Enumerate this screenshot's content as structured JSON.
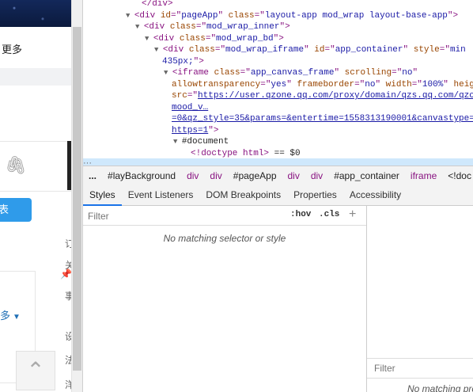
{
  "left_page": {
    "more_label": "更多",
    "publish_label": "表",
    "more_dropdown_label": "多",
    "fragments": [
      "订",
      "关",
      "事",
      "设",
      "法",
      "洋"
    ],
    "attach_icon": "paperclip-icon",
    "top_icon": "chevron-up-icon"
  },
  "elements": {
    "lines": [
      {
        "indent": 74,
        "parts": [
          [
            "tag",
            "</div>"
          ]
        ]
      },
      {
        "indent": 64,
        "tri": "▼",
        "parts": [
          [
            "tag",
            "<div "
          ],
          [
            "attr",
            "id"
          ],
          [
            "tag",
            "=\""
          ],
          [
            "val",
            "pageApp"
          ],
          [
            "tag",
            "\" "
          ],
          [
            "attr",
            "class"
          ],
          [
            "tag",
            "=\""
          ],
          [
            "val",
            "layout-app mod_wrap layout-base-app"
          ],
          [
            "tag",
            "\">"
          ]
        ]
      },
      {
        "indent": 76,
        "tri": "▼",
        "parts": [
          [
            "tag",
            "<div "
          ],
          [
            "attr",
            "class"
          ],
          [
            "tag",
            "=\""
          ],
          [
            "val",
            "mod_wrap_inner"
          ],
          [
            "tag",
            "\">"
          ]
        ]
      },
      {
        "indent": 88,
        "tri": "▼",
        "parts": [
          [
            "tag",
            "<div "
          ],
          [
            "attr",
            "class"
          ],
          [
            "tag",
            "=\""
          ],
          [
            "val",
            "mod_wrap_bd"
          ],
          [
            "tag",
            "\">"
          ]
        ]
      },
      {
        "indent": 100,
        "tri": "▼",
        "parts": [
          [
            "tag",
            "<div "
          ],
          [
            "attr",
            "class"
          ],
          [
            "tag",
            "=\""
          ],
          [
            "val",
            "mod_wrap_iframe"
          ],
          [
            "tag",
            "\" "
          ],
          [
            "attr",
            "id"
          ],
          [
            "tag",
            "=\""
          ],
          [
            "val",
            "app_container"
          ],
          [
            "tag",
            "\" "
          ],
          [
            "attr",
            "style"
          ],
          [
            "tag",
            "=\""
          ],
          [
            "val",
            "min"
          ]
        ]
      },
      {
        "indent": 100,
        "parts": [
          [
            "val",
            "435px;"
          ],
          [
            "tag",
            "\">"
          ]
        ]
      },
      {
        "indent": 112,
        "tri": "▼",
        "parts": [
          [
            "tag",
            "<iframe "
          ],
          [
            "attr",
            "class"
          ],
          [
            "tag",
            "=\""
          ],
          [
            "val",
            "app_canvas_frame"
          ],
          [
            "tag",
            "\" "
          ],
          [
            "attr",
            "scrolling"
          ],
          [
            "tag",
            "=\""
          ],
          [
            "val",
            "no"
          ],
          [
            "tag",
            "\""
          ]
        ]
      },
      {
        "indent": 112,
        "parts": [
          [
            "attr",
            "allowtransparency"
          ],
          [
            "tag",
            "=\""
          ],
          [
            "val",
            "yes"
          ],
          [
            "tag",
            "\" "
          ],
          [
            "attr",
            "frameborder"
          ],
          [
            "tag",
            "=\""
          ],
          [
            "val",
            "no"
          ],
          [
            "tag",
            "\" "
          ],
          [
            "attr",
            "width"
          ],
          [
            "tag",
            "=\""
          ],
          [
            "val",
            "100%"
          ],
          [
            "tag",
            "\" "
          ],
          [
            "attr",
            "heig"
          ]
        ]
      },
      {
        "indent": 112,
        "parts": [
          [
            "attr",
            "src"
          ],
          [
            "tag",
            "=\""
          ],
          [
            "link",
            "https://user.qzone.qq.com/proxy/domain/qzs.qq.com/qzo"
          ]
        ]
      },
      {
        "indent": 112,
        "parts": [
          [
            "link",
            "mood_v…"
          ]
        ]
      },
      {
        "indent": 112,
        "parts": [
          [
            "link",
            "=0&qz_style=35&params=&entertime=1558313190001&canvastype="
          ]
        ]
      },
      {
        "indent": 112,
        "parts": [
          [
            "link",
            "https=1"
          ],
          [
            "tag",
            "\">"
          ]
        ]
      },
      {
        "indent": 124,
        "tri": "▼",
        "parts": [
          [
            "txt",
            "#document"
          ]
        ]
      },
      {
        "indent": 136,
        "parts": [
          [
            "tag",
            "<!doctype html>"
          ],
          [
            "txt",
            " == $0"
          ]
        ]
      }
    ]
  },
  "breadcrumb": [
    "...",
    "#layBackground",
    "div",
    "div",
    "#pageApp",
    "div",
    "div",
    "#app_container",
    "iframe",
    "<!doc"
  ],
  "tabs": [
    "Styles",
    "Event Listeners",
    "DOM Breakpoints",
    "Properties",
    "Accessibility"
  ],
  "active_tab": "Styles",
  "styles": {
    "filter_placeholder": "Filter",
    "hov_label": ":hov",
    "cls_label": ".cls",
    "add_label": "+",
    "no_match": "No matching selector or style"
  },
  "computed": {
    "filter_placeholder": "Filter",
    "no_match": "No matching pro"
  },
  "colors": {
    "accent": "#1a73e8",
    "publish_button": "#2f9bea",
    "tag": "#881280",
    "attr": "#994500",
    "value": "#1a1aa6"
  }
}
